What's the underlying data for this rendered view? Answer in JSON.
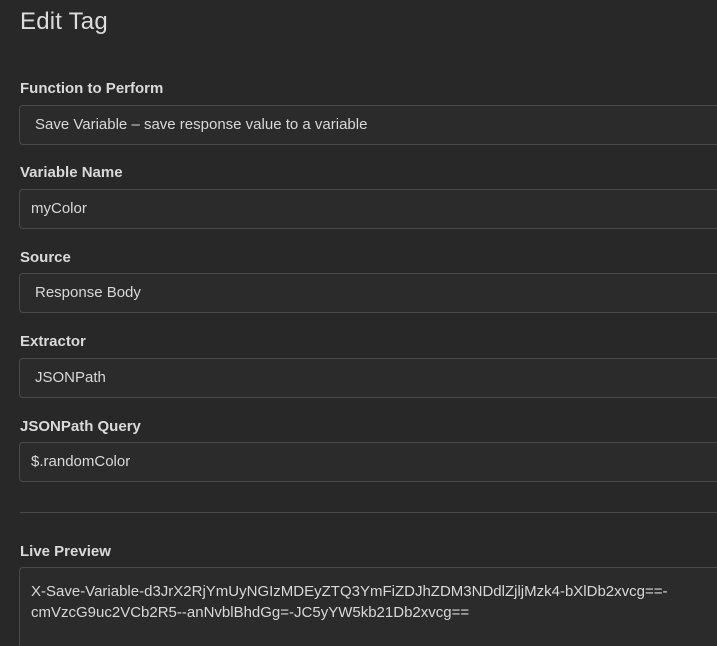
{
  "dialog": {
    "title": "Edit Tag"
  },
  "form": {
    "function": {
      "label": "Function to Perform",
      "value": "Save Variable – save response value to a variable"
    },
    "variable_name": {
      "label": "Variable Name",
      "value": "myColor"
    },
    "source": {
      "label": "Source",
      "value": "Response Body"
    },
    "extractor": {
      "label": "Extractor",
      "value": "JSONPath"
    },
    "query": {
      "label": "JSONPath Query",
      "value": "$.randomColor"
    }
  },
  "preview": {
    "label": "Live Preview",
    "line1": "X-Save-Variable-d3JrX2RjYmUyNGIzMDEyZTQ3YmFiZDJhZDM3NDdlZjljMzk4-bXlDb2xvcg==-",
    "line2": "cmVzcG9uc2VCb2R5--anNvblBhdGg=-JC5yYW5kb21Db2xvcg=="
  }
}
